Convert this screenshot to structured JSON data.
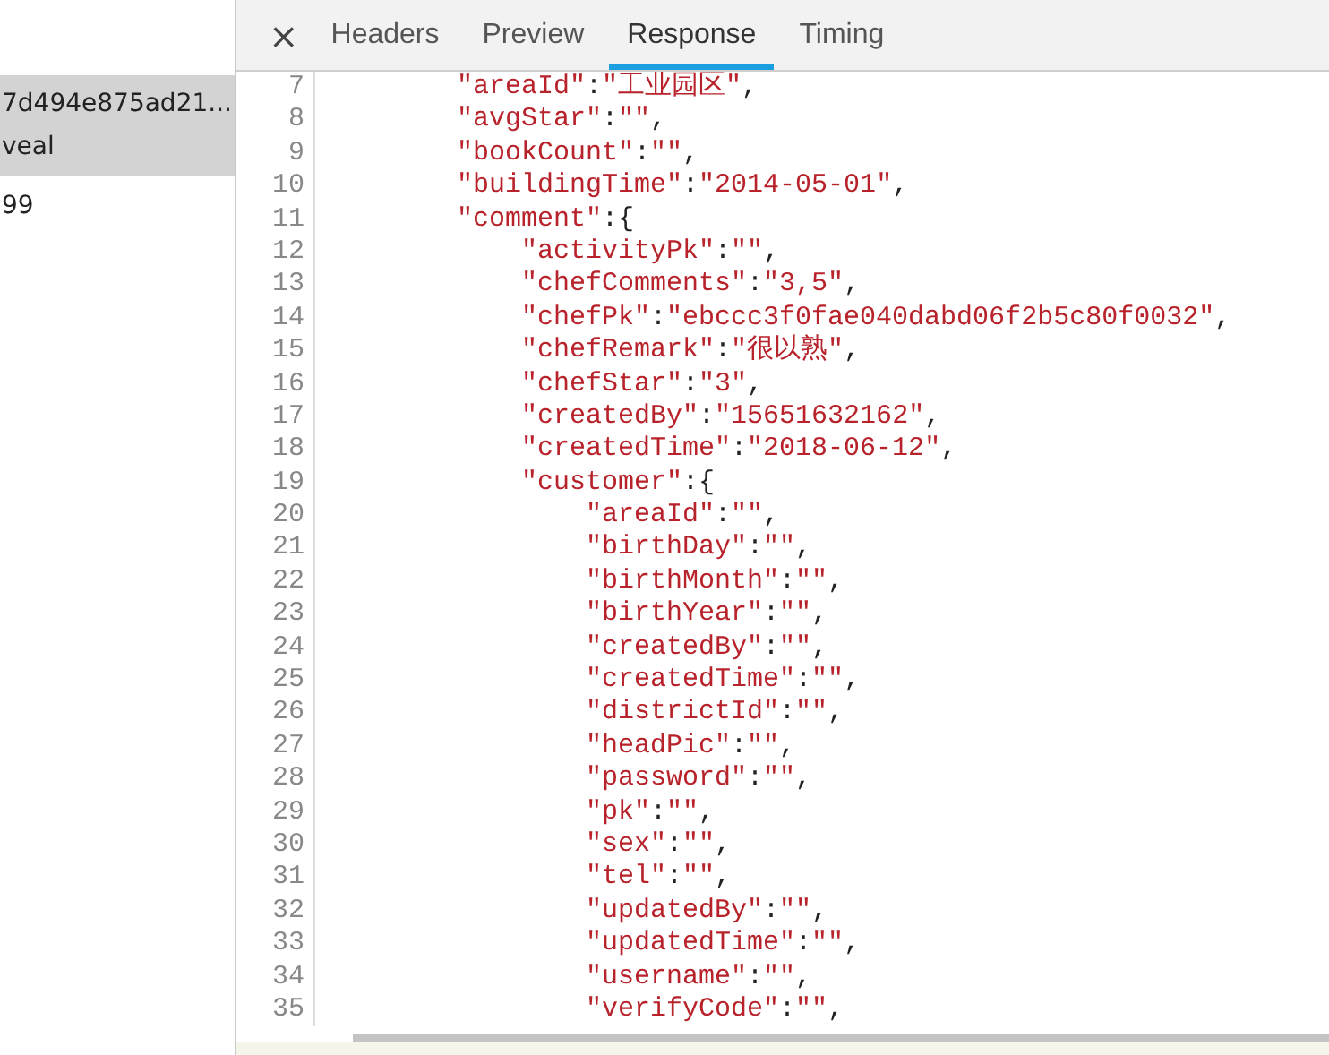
{
  "request_list": {
    "items": [
      {
        "lines": [
          "7d494e875ad21...",
          "veal"
        ],
        "selected": true
      },
      {
        "lines": [
          "99"
        ],
        "selected": false
      }
    ]
  },
  "detail_tabs": {
    "close": "×",
    "tabs": [
      {
        "label": "Headers",
        "selected": false
      },
      {
        "label": "Preview",
        "selected": false
      },
      {
        "label": "Response",
        "selected": true
      },
      {
        "label": "Timing",
        "selected": false
      }
    ]
  },
  "response_code": {
    "lines": [
      {
        "number": "7",
        "text": "\"areaId\":\"工业园区\","
      },
      {
        "number": "8",
        "text": "\"avgStar\":\"\","
      },
      {
        "number": "9",
        "text": "\"bookCount\":\"\","
      },
      {
        "number": "10",
        "text": "\"buildingTime\":\"2014-05-01\","
      },
      {
        "number": "11",
        "text": "\"comment\":{",
        "children": [
          {
            "number": "12",
            "text": "\"activityPk\":\"\","
          },
          {
            "number": "13",
            "text": "\"chefComments\":\"3,5\","
          },
          {
            "number": "14",
            "text": "\"chefPk\":\"ebccc3f0fae040dabd06f2b5c80f0032\","
          },
          {
            "number": "15",
            "text": "\"chefRemark\":\"很以熟\","
          },
          {
            "number": "16",
            "text": "\"chefStar\":\"3\","
          },
          {
            "number": "17",
            "text": "\"createdBy\":\"15651632162\","
          },
          {
            "number": "18",
            "text": "\"createdTime\":\"2018-06-12\","
          },
          {
            "number": "19",
            "text": "\"customer\":{",
            "children": [
              {
                "number": "20",
                "text": "\"areaId\":\"\","
              },
              {
                "number": "21",
                "text": "\"birthDay\":\"\","
              },
              {
                "number": "22",
                "text": "\"birthMonth\":\"\","
              },
              {
                "number": "23",
                "text": "\"birthYear\":\"\","
              },
              {
                "number": "24",
                "text": "\"createdBy\":\"\","
              },
              {
                "number": "25",
                "text": "\"createdTime\":\"\","
              },
              {
                "number": "26",
                "text": "\"districtId\":\"\","
              },
              {
                "number": "27",
                "text": "\"headPic\":\"\","
              },
              {
                "number": "28",
                "text": "\"password\":\"\","
              },
              {
                "number": "29",
                "text": "\"pk\":\"\","
              },
              {
                "number": "30",
                "text": "\"sex\":\"\","
              },
              {
                "number": "31",
                "text": "\"tel\":\"\","
              },
              {
                "number": "32",
                "text": "\"updatedBy\":\"\","
              },
              {
                "number": "33",
                "text": "\"updatedTime\":\"\","
              },
              {
                "number": "34",
                "text": "\"username\":\"\","
              },
              {
                "number": "35",
                "text": "\"verifyCode\":\"\","
              }
            ]
          }
        ]
      }
    ]
  }
}
